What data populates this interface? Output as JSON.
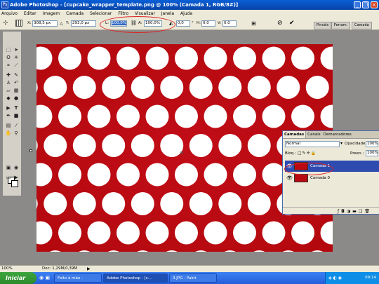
{
  "window": {
    "title": "Adobe Photoshop - [cupcake_wrapper_template.png @ 100% (Camada 1, RGB/8#)]",
    "logo": "Ps",
    "controls": [
      "_",
      "❐",
      "×"
    ]
  },
  "menu": [
    "Arquivo",
    "Editar",
    "Imagem",
    "Camada",
    "Selecionar",
    "Filtro",
    "Visualizar",
    "Janela",
    "Ajuda"
  ],
  "options": {
    "x_label": "X:",
    "x_value": "308,5 px",
    "y_label": "Y:",
    "y_value": "293,0 px",
    "w_label": "L:",
    "w_value": "100,0%",
    "h_label": "A:",
    "h_value": "100,0%",
    "angle_value": "0,0",
    "angle_unit": "°",
    "hskew_label": "H:",
    "hskew_value": "0,0",
    "vskew_label": "V:",
    "vskew_value": "0,0",
    "tabs": [
      "Pincéis",
      "Ferram.",
      "Camada"
    ]
  },
  "toolbox": {
    "tools": [
      "marquee",
      "move",
      "lasso",
      "magic-wand",
      "crop",
      "slice",
      "healing",
      "brush",
      "stamp",
      "history-brush",
      "eraser",
      "gradient",
      "blur",
      "dodge",
      "path-select",
      "type",
      "pen",
      "shape",
      "notes",
      "eyedropper",
      "hand",
      "zoom"
    ]
  },
  "status": {
    "zoom": "100%",
    "doc": "Doc: 1,29M/0,39M"
  },
  "layers_panel": {
    "tabs": [
      "Camadas",
      "Canais",
      "Demarcadores"
    ],
    "blend_mode": "Normal",
    "opacity_label": "Opacidade:",
    "opacity_value": "100%",
    "lock_label": "Bloq.:",
    "fill_label": "Preen.:",
    "fill_value": "100%",
    "layers": [
      {
        "name": "Camada 1",
        "selected": true
      },
      {
        "name": "Camada 0",
        "selected": false
      }
    ]
  },
  "taskbar": {
    "start": "Iniciar",
    "tasks": [
      {
        "label": "Feito à mão - Window...",
        "active": false
      },
      {
        "label": "Adobe Photoshop - [c...",
        "active": true
      },
      {
        "label": "3.JPG - Paint",
        "active": false
      }
    ],
    "clock": "09:14"
  },
  "colors": {
    "canvas_red": "#b90a13",
    "annotation_red": "#dd2222",
    "selected_layer": "#2e4bb0"
  }
}
